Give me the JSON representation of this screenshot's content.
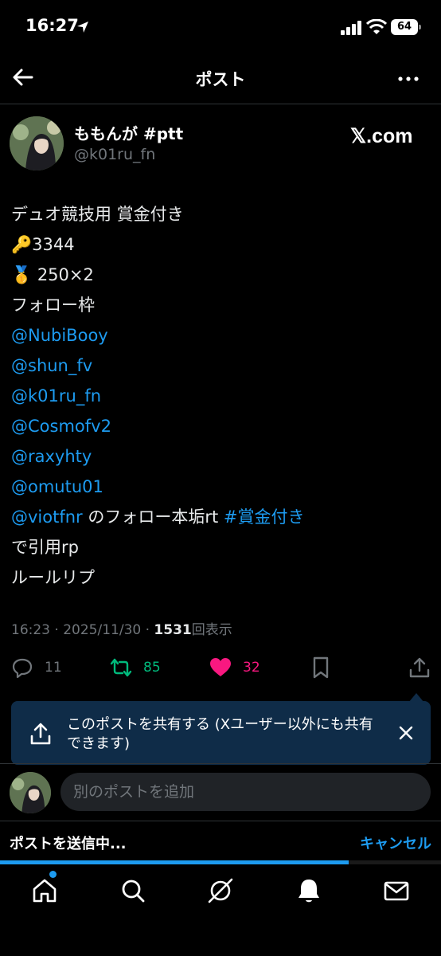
{
  "status_bar": {
    "time": "16:27",
    "battery": "64"
  },
  "header": {
    "title": "ポスト"
  },
  "author": {
    "name": "ももんが #ptt",
    "handle": "@k01ru_fn",
    "watermark": "𝕏.com"
  },
  "post_lines": [
    "デュオ競技用 賞金付き",
    "🔑3344",
    "🥇 250×2",
    "フォロー枠",
    "@NubiBooy",
    "@shun_fv",
    "@k01ru_fn",
    "@Cosmofv2",
    "@raxyhty",
    "@omutu01",
    {
      "mention": "@viotfnr",
      "middle": " のフォロー本垢rt ",
      "hashtag": "#賞金付き"
    },
    "で引用rp",
    "ルールリプ"
  ],
  "meta": {
    "time": "16:23",
    "date": "2025/11/30",
    "views": "1531",
    "views_label": "回表示"
  },
  "actions": {
    "replies": "11",
    "retweets": "85",
    "likes": "32"
  },
  "share_banner": {
    "text": "このポストを共有する (Xユーザー以外にも共有できます)"
  },
  "reply": {
    "placeholder": "別のポストを追加"
  },
  "sending": {
    "label": "ポストを送信中...",
    "cancel": "キャンセル",
    "progress": 0.79
  },
  "colors": {
    "link": "#1d9bf0",
    "retweet": "#00ba7c",
    "like": "#f91880"
  }
}
